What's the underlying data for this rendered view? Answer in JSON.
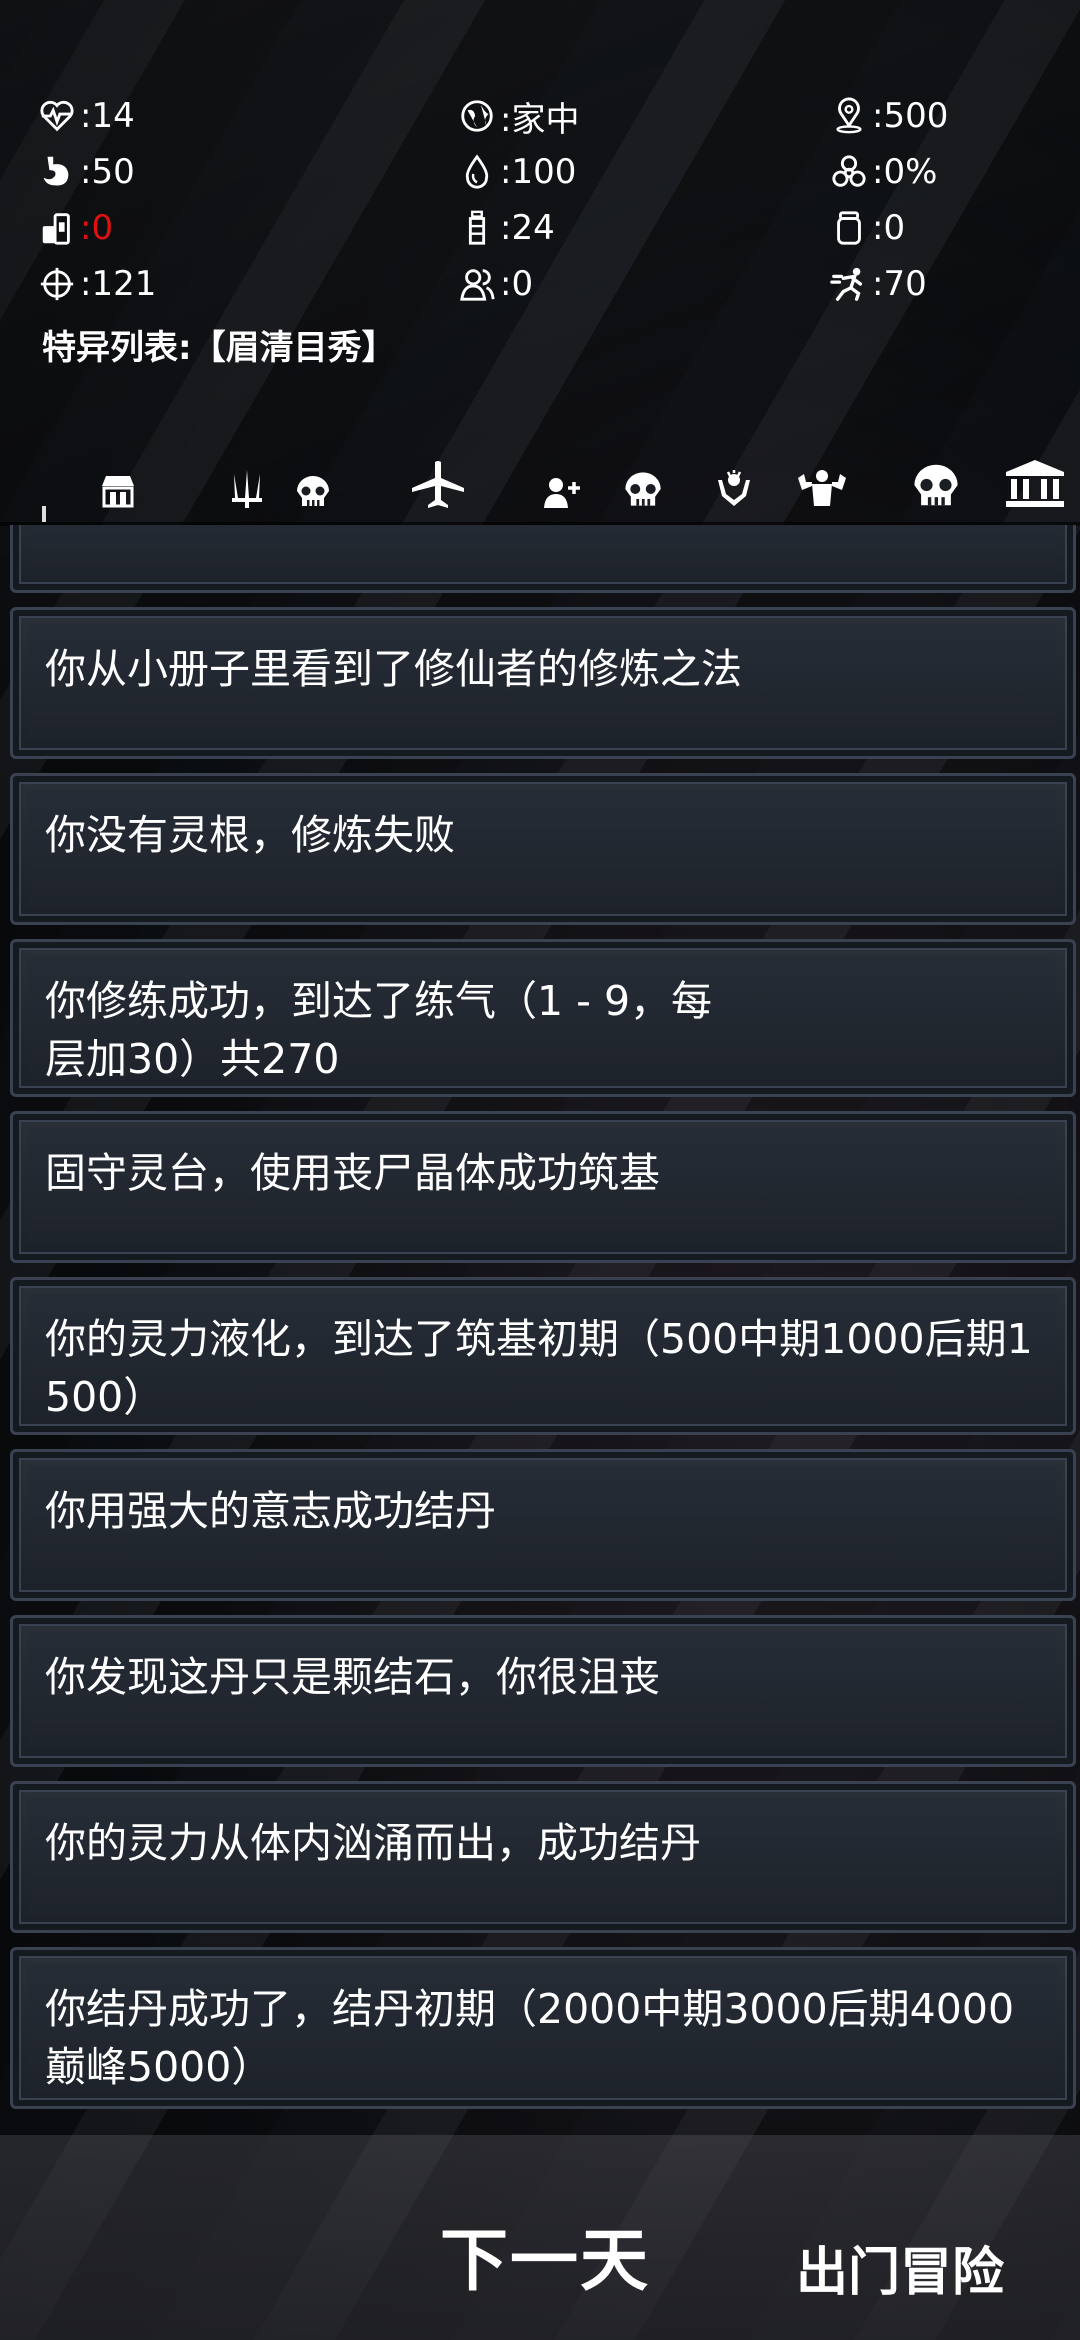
{
  "stats": [
    [
      {
        "icon": "heartbeat-icon",
        "value": ":14"
      },
      {
        "icon": "globe-icon",
        "value": ":家中"
      },
      {
        "icon": "map-pin-icon",
        "value": ":500"
      }
    ],
    [
      {
        "icon": "stomach-icon",
        "value": ":50"
      },
      {
        "icon": "water-drop-icon",
        "value": ":100"
      },
      {
        "icon": "biohazard-icon",
        "value": ":0%"
      }
    ],
    [
      {
        "icon": "food-icon",
        "value": ":0",
        "color": "#e01010"
      },
      {
        "icon": "water-bottle-icon",
        "value": ":24"
      },
      {
        "icon": "jar-icon",
        "value": ":0"
      }
    ],
    [
      {
        "icon": "crosshair-icon",
        "value": ":121"
      },
      {
        "icon": "people-icon",
        "value": ":0"
      },
      {
        "icon": "running-icon",
        "value": ":70"
      }
    ]
  ],
  "trait_list": "特异列表:【眉清目秀】",
  "tabs": [
    "shop-icon",
    "weapons-icon",
    "skull-icon",
    "airplane-icon",
    "add-user-icon",
    "skull-icon",
    "hands-icon",
    "muscle-icon",
    "skull-icon",
    "bank-icon"
  ],
  "log": [
    "",
    "你从小册子里看到了修仙者的修炼之法",
    "你没有灵根，修炼失败",
    "你修练成功，到达了练气（1 - 9，每层加30）共270",
    "固守灵台，使用丧尸晶体成功筑基",
    "你的灵力液化，到达了筑基初期（500中期1000后期1500）",
    "你用强大的意志成功结丹",
    "你发现这丹只是颗结石，你很沮丧",
    "你的灵力从体内汹涌而出，成功结丹",
    "你结丹成功了，结丹初期（2000中期3000后期4000巅峰5000）"
  ],
  "buttons": {
    "next_day": "下一天",
    "go_out": "出门冒险"
  },
  "colors": {
    "warning": "#e01010",
    "card": "#242a33"
  }
}
